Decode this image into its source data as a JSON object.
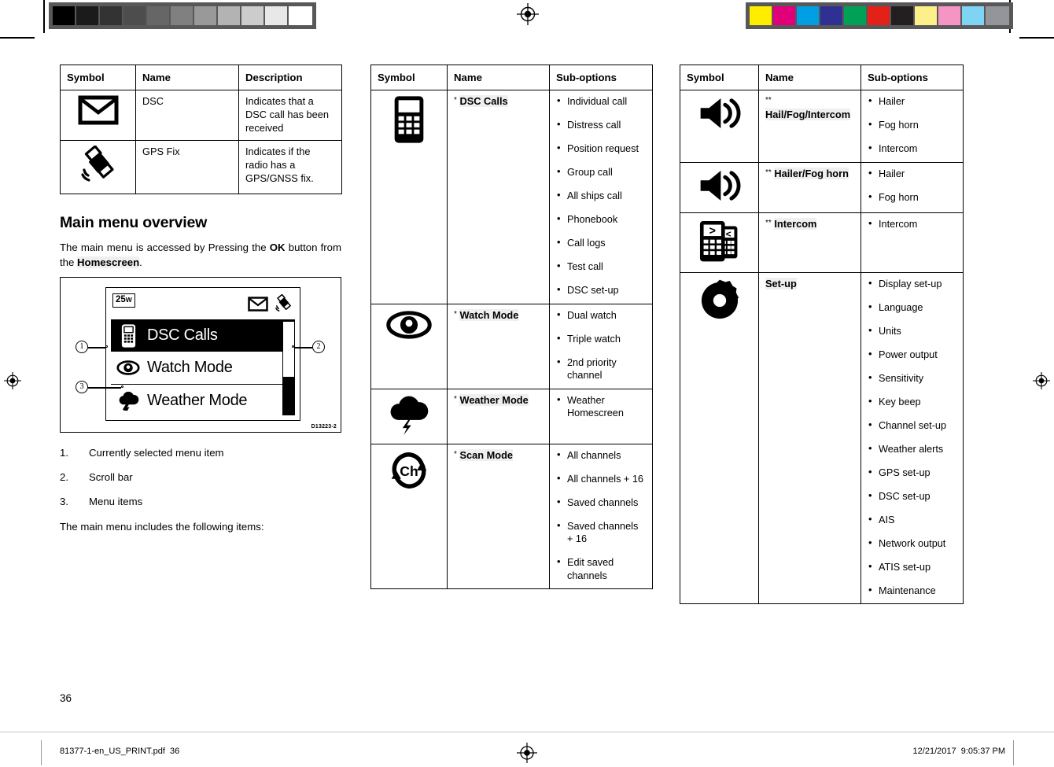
{
  "calibration": {
    "grayscale": [
      "#000000",
      "#1b1b1b",
      "#333333",
      "#4d4d4d",
      "#666666",
      "#808080",
      "#999999",
      "#b3b3b3",
      "#cccccc",
      "#e8e8e8",
      "#ffffff"
    ],
    "colors": [
      "#ffed00",
      "#e2007a",
      "#009fe3",
      "#2e3192",
      "#00a157",
      "#e32119",
      "#231f20",
      "#fdf08a",
      "#f595c4",
      "#7fd4f4",
      "#939598"
    ],
    "registration_icon": "registration-target-icon"
  },
  "left_column": {
    "table": {
      "headers": [
        "Symbol",
        "Name",
        "Description"
      ],
      "rows": [
        {
          "icon": "envelope-icon",
          "name": "DSC",
          "description": "Indicates that a DSC call has been received"
        },
        {
          "icon": "satellite-icon",
          "name": "GPS Fix",
          "description": "Indicates if the radio has a GPS/GNSS fix."
        }
      ]
    },
    "heading": "Main menu overview",
    "intro_parts": [
      {
        "text": "The main menu is accessed by Pressing the ",
        "style": "normal"
      },
      {
        "text": "OK",
        "style": "bold"
      },
      {
        "text": " button from the ",
        "style": "normal"
      },
      {
        "text": "Homescreen",
        "style": "bold"
      },
      {
        "text": ".",
        "style": "normal"
      }
    ],
    "intro_text": "The main menu is accessed by Pressing the OK button from the Homescreen.",
    "figure": {
      "power_badge": "25",
      "power_unit": "W",
      "status_icons": [
        "envelope-icon",
        "satellite-icon"
      ],
      "menu_items": [
        {
          "label": "DSC Calls",
          "icon": "handset-icon",
          "selected": true
        },
        {
          "label": "Watch Mode",
          "icon": "eye-icon",
          "selected": false
        },
        {
          "label": "Weather Mode",
          "icon": "storm-cloud-icon",
          "selected": false
        }
      ],
      "callouts": [
        "1",
        "2",
        "3"
      ],
      "figure_id": "D13223-2"
    },
    "numbered_list": [
      {
        "num": "1.",
        "label": "Currently selected menu item"
      },
      {
        "num": "2.",
        "label": "Scroll bar"
      },
      {
        "num": "3.",
        "label": "Menu items"
      }
    ],
    "closing_text": "The main menu includes the following items:"
  },
  "middle_column": {
    "table": {
      "headers": [
        "Symbol",
        "Name",
        "Sub-options"
      ],
      "rows": [
        {
          "icon": "handset-icon",
          "marker": "*",
          "name": "DSC Calls",
          "sub_options": [
            "Individual call",
            "Distress call",
            "Position request",
            "Group call",
            "All ships call",
            "Phonebook",
            "Call logs",
            "Test call",
            "DSC set-up"
          ]
        },
        {
          "icon": "eye-icon",
          "marker": "*",
          "name": "Watch Mode",
          "sub_options": [
            "Dual watch",
            "Triple watch",
            "2nd priority channel"
          ]
        },
        {
          "icon": "storm-cloud-icon",
          "marker": "*",
          "name": "Weather Mode",
          "sub_options": [
            "Weather Homescreen"
          ]
        },
        {
          "icon": "channel-scan-icon",
          "marker": "*",
          "name": "Scan Mode",
          "sub_options": [
            "All channels",
            "All channels + 16",
            "Saved channels",
            "Saved channels + 16",
            "Edit saved channels"
          ]
        }
      ]
    }
  },
  "right_column": {
    "table": {
      "headers": [
        "Symbol",
        "Name",
        "Sub-options"
      ],
      "rows": [
        {
          "icon": "speaker-icon",
          "marker": "**",
          "name": "Hail/Fog/Intercom",
          "sub_options": [
            "Hailer",
            "Fog horn",
            "Intercom"
          ]
        },
        {
          "icon": "speaker-icon",
          "marker": "**",
          "name": "Hailer/Fog horn",
          "sub_options": [
            "Hailer",
            "Fog horn"
          ]
        },
        {
          "icon": "two-handsets-icon",
          "marker": "**",
          "name": "Intercom",
          "sub_options": [
            "Intercom"
          ]
        },
        {
          "icon": "gear-icon",
          "marker": "",
          "name": "Set-up",
          "sub_options": [
            "Display set-up",
            "Language",
            "Units",
            "Power output",
            "Sensitivity",
            "Key beep",
            "Channel set-up",
            "Weather alerts",
            "GPS set-up",
            "DSC set-up",
            "AIS",
            "Network output",
            "ATIS set-up",
            "Maintenance"
          ]
        }
      ]
    }
  },
  "footer": {
    "page_number": "36",
    "file_name": "81377-1-en_US_PRINT.pdf",
    "file_page": "36",
    "date": "12/21/2017",
    "time": "9:05:37 PM"
  }
}
